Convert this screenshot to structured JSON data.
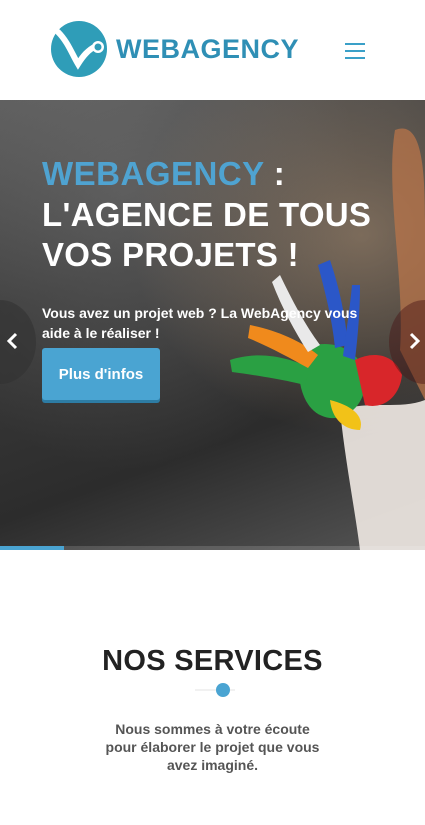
{
  "brand": {
    "name": "WEBAGENCY",
    "color": "#2f8fb5"
  },
  "header": {
    "menu_icon": "hamburger-icon"
  },
  "hero": {
    "title_accent": "WEBAGENCY",
    "title_suffix": " :",
    "title_line2": "L'AGENCE DE TOUS VOS PROJETS !",
    "text": "Vous avez un projet web ? La WebAgency vous aide à le réaliser !",
    "button_label": "Plus d'infos",
    "prev_icon": "chevron-left-icon",
    "next_icon": "chevron-right-icon",
    "slide_progress": 0.15
  },
  "services": {
    "title": "NOS SERVICES",
    "text": "Nous sommes à votre écoute pour élaborer le projet que vous avez imaginé."
  },
  "colors": {
    "accent": "#4aa4d2",
    "heading": "#222222"
  }
}
